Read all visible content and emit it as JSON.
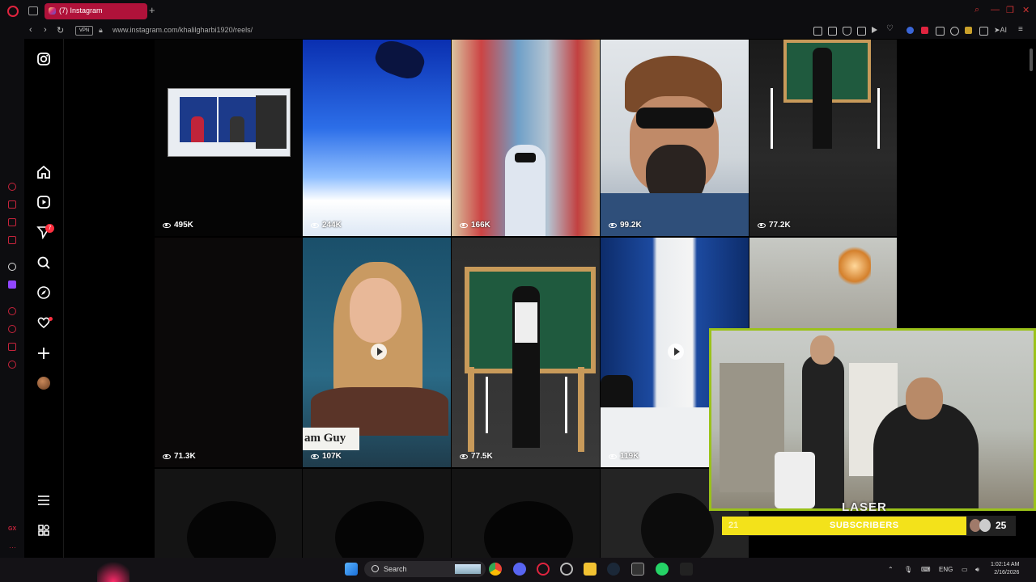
{
  "browser": {
    "tab_title": "(7) Instagram",
    "new_tab": "+",
    "vpn_label": "VPN",
    "url": "www.instagram.com/khalilgharbi1920/reels/",
    "ai_label": "AI"
  },
  "instagram": {
    "notification_count": "7"
  },
  "reels": [
    {
      "views": "495K"
    },
    {
      "views": "244K"
    },
    {
      "views": "166K"
    },
    {
      "views": "99.2K"
    },
    {
      "views": "77.2K"
    },
    {
      "views": "71.3K"
    },
    {
      "views": "107K",
      "caption": "am Guy"
    },
    {
      "views": "77.5K"
    },
    {
      "views": "119K"
    }
  ],
  "stream": {
    "logo_text": "LASER",
    "sub_current": "21",
    "sub_label": "SUBSCRIBERS",
    "sub_goal": "25"
  },
  "taskbar": {
    "search_label": "Search",
    "language": "ENG",
    "time": "1:02:14 AM",
    "date": "2/16/2026"
  },
  "colors": {
    "accent_opera": "#e0243f",
    "tab_active": "#b0123a",
    "sub_bar": "#f3e21a",
    "cam_border": "#9bc21a"
  }
}
